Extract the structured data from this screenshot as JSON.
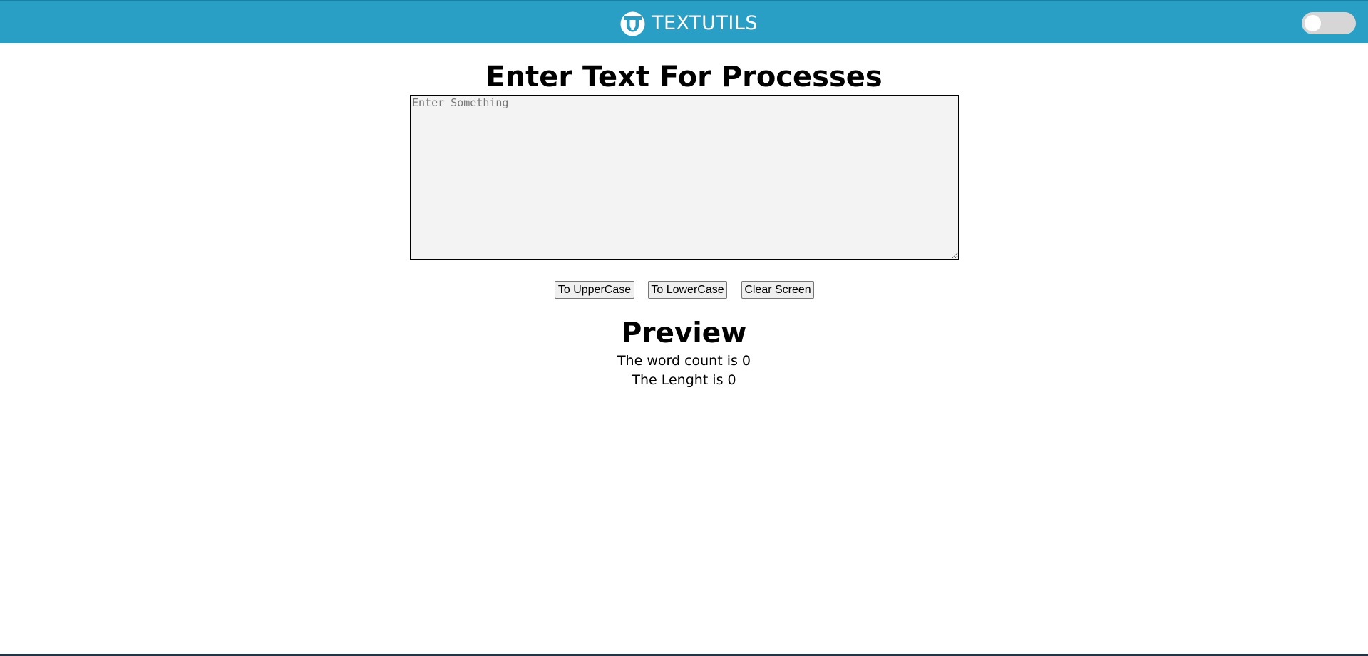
{
  "navbar": {
    "brand_name": "TEXTUTILS",
    "logo_icon": "textutils-logo-icon",
    "dark_mode_toggle": {
      "enabled": false
    }
  },
  "main": {
    "heading": "Enter Text For Processes",
    "textarea": {
      "value": "",
      "placeholder": "Enter Something"
    },
    "buttons": {
      "uppercase": "To UpperCase",
      "lowercase": "To LowerCase",
      "clear": "Clear Screen"
    }
  },
  "preview": {
    "title": "Preview",
    "word_count_text": "The word count is 0",
    "length_text": "The Lenght is 0"
  },
  "colors": {
    "navbar_bg": "#2a9fc5",
    "page_bg": "#ffffff",
    "textarea_bg": "#f3f3f3",
    "toggle_off": "#d6d6d6"
  }
}
